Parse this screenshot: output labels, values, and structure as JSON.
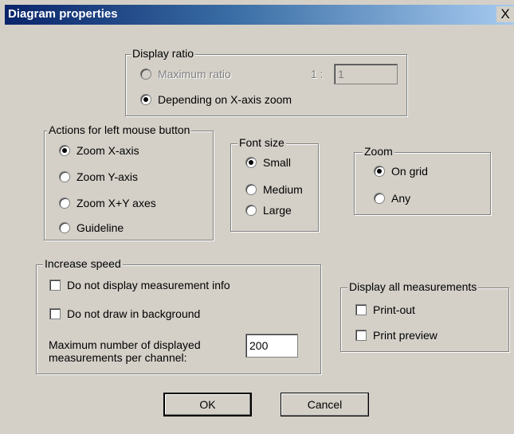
{
  "window": {
    "title": "Diagram properties",
    "close_glyph": "X"
  },
  "display_ratio": {
    "legend": "Display ratio",
    "maximum_ratio_label": "Maximum ratio",
    "ratio_prefix": "1 :",
    "ratio_value": "1",
    "depending_label": "Depending on X-axis zoom",
    "selected": "Depending on X-axis zoom"
  },
  "mouse_actions": {
    "legend": "Actions for left mouse button",
    "options": [
      "Zoom X-axis",
      "Zoom Y-axis",
      "Zoom X+Y axes",
      "Guideline"
    ],
    "selected": "Zoom X-axis"
  },
  "font_size": {
    "legend": "Font size",
    "options": [
      "Small",
      "Medium",
      "Large"
    ],
    "selected": "Small"
  },
  "zoom": {
    "legend": "Zoom",
    "options": [
      "On grid",
      "Any"
    ],
    "selected": "On grid"
  },
  "increase_speed": {
    "legend": "Increase speed",
    "no_measurement_info": "Do not display measurement info",
    "no_background_draw": "Do not draw in background",
    "max_measurements_label_1": "Maximum number of displayed",
    "max_measurements_label_2": "measurements per channel:",
    "max_measurements_value": "200"
  },
  "display_all": {
    "legend": "Display all measurements",
    "printout": "Print-out",
    "print_preview": "Print preview"
  },
  "buttons": {
    "ok": "OK",
    "cancel": "Cancel"
  }
}
